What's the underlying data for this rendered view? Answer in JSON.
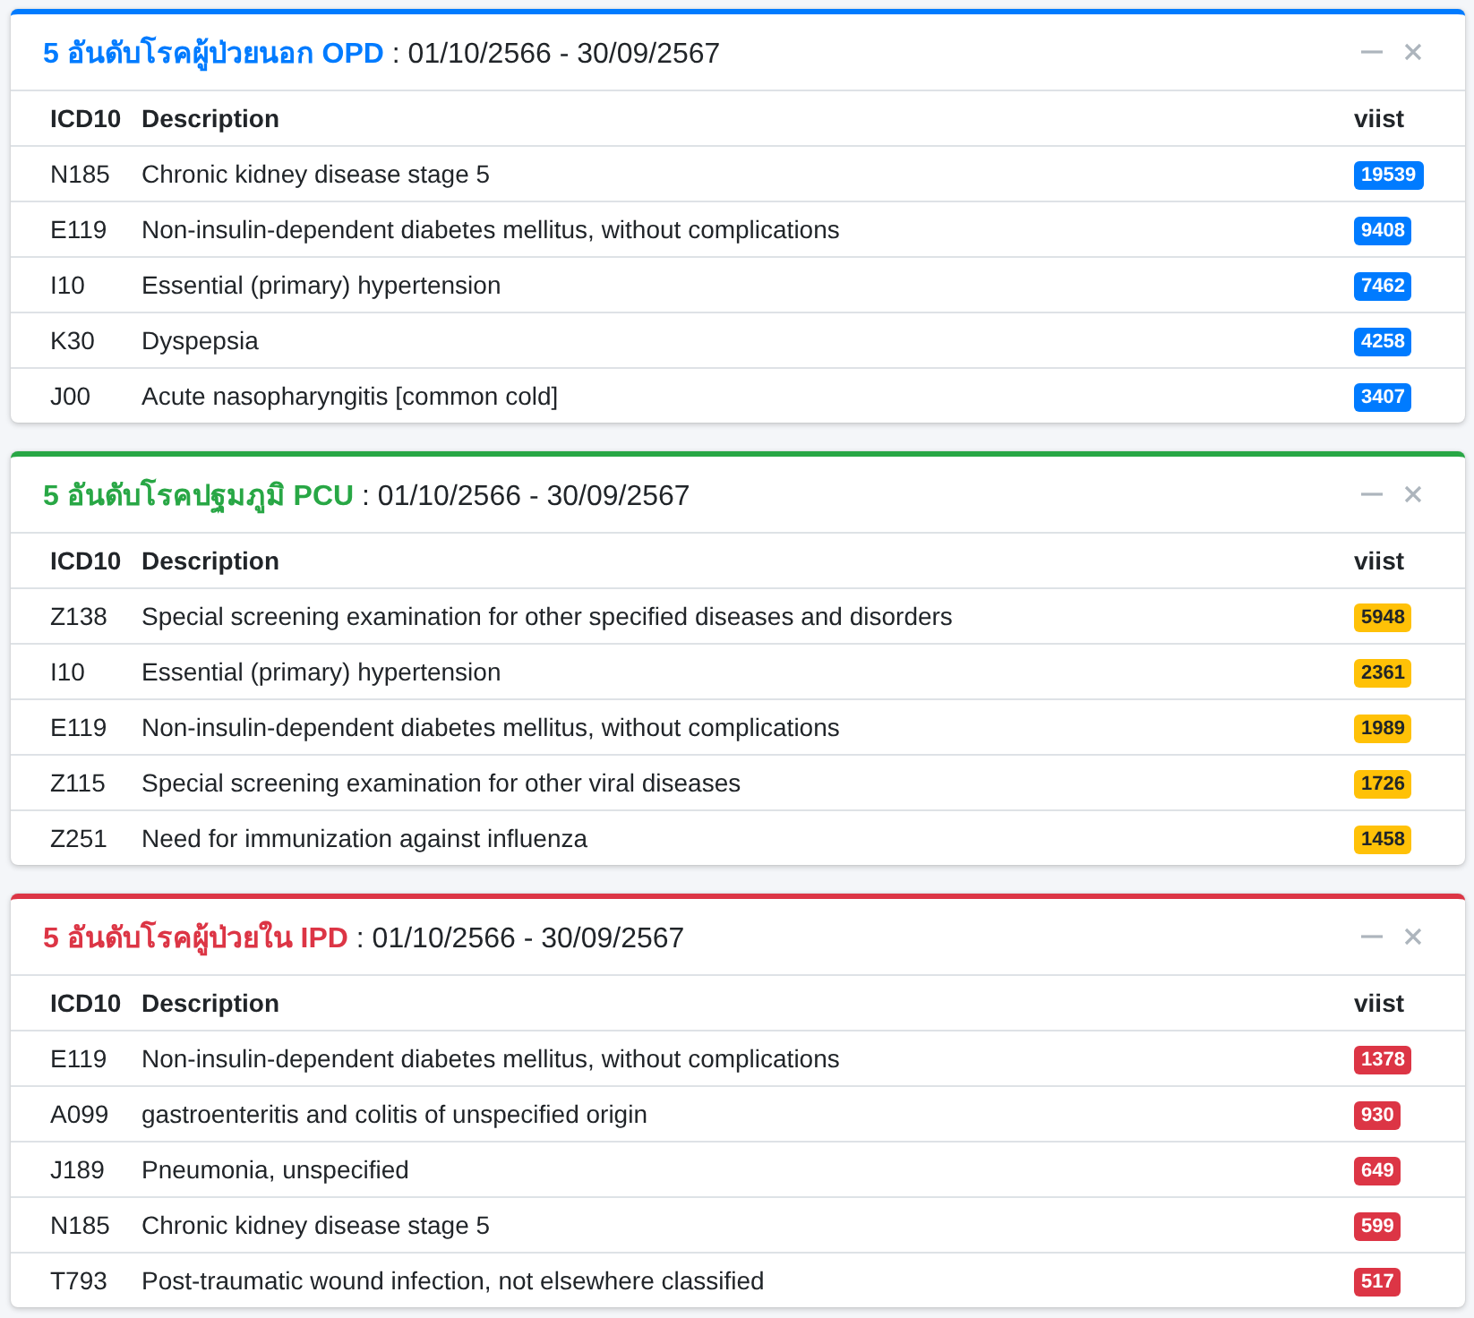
{
  "cards": [
    {
      "title": "**5 อันดับโรคผู้ป่วยนอก OPD** : 01/10/2566 - 30/09/2567",
      "color": "#007bff",
      "columns": [
        "ICD10",
        "Description",
        "viist"
      ],
      "rows": [
        {
          "code": "N185",
          "description": "Chronic kidney disease stage 5",
          "visits": "19539",
          "color": "#007bff"
        },
        {
          "code": "E119",
          "description": "Non-insulin-dependent diabetes mellitus, without complications",
          "visits": "9408",
          "color": "#007bff"
        },
        {
          "code": "I10",
          "description": "Essential (primary) hypertension",
          "visits": "7462",
          "color": "#007bff"
        },
        {
          "code": "K30",
          "description": "Dyspepsia",
          "visits": "4258",
          "color": "#007bff"
        },
        {
          "code": "J00",
          "description": "Acute nasopharyngitis [common cold]",
          "visits": "3407",
          "color": "#007bff"
        }
      ]
    },
    {
      "title": "**5 อันดับโรคปฐมภูมิ PCU** : 01/10/2566 - 30/09/2567",
      "color": "#28a745",
      "columns": [
        "ICD10",
        "Description",
        "viist"
      ],
      "rows": [
        {
          "code": "Z138",
          "description": "Special screening examination for other specified diseases and disorders",
          "visits": "5948",
          "color": "#ffc107"
        },
        {
          "code": "I10",
          "description": "Essential (primary) hypertension",
          "visits": "2361",
          "color": "#ffc107"
        },
        {
          "code": "E119",
          "description": "Non-insulin-dependent diabetes mellitus, without complications",
          "visits": "1989",
          "color": "#ffc107"
        },
        {
          "code": "Z115",
          "description": "Special screening examination for other viral diseases",
          "visits": "1726",
          "color": "#ffc107"
        },
        {
          "code": "Z251",
          "description": "Need for immunization against influenza",
          "visits": "1458",
          "color": "#ffc107"
        }
      ]
    },
    {
      "title": "**5 อันดับโรคผู้ป่วยใน IPD** : 01/10/2566 - 30/09/2567",
      "color": "#dc3545",
      "columns": [
        "ICD10",
        "Description",
        "viist"
      ],
      "rows": [
        {
          "code": "E119",
          "description": "Non-insulin-dependent diabetes mellitus, without complications",
          "visits": "1378",
          "color": "#dc3545"
        },
        {
          "code": "A099",
          "description": "gastroenteritis and colitis of unspecified origin",
          "visits": "930",
          "color": "#dc3545"
        },
        {
          "code": "J189",
          "description": "Pneumonia, unspecified",
          "visits": "649",
          "color": "#dc3545"
        },
        {
          "code": "N185",
          "description": "Chronic kidney disease stage 5",
          "visits": "599",
          "color": "#dc3545"
        },
        {
          "code": "T793",
          "description": "Post-traumatic wound infection, not elsewhere classified",
          "visits": "517",
          "color": "#dc3545"
        }
      ]
    }
  ]
}
